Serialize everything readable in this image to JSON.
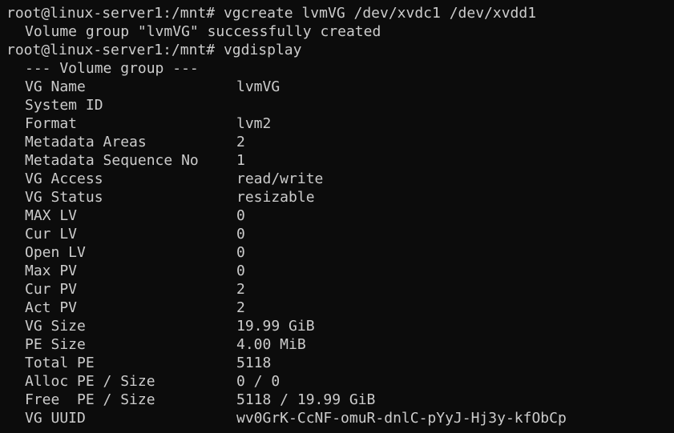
{
  "terminal": {
    "prompt": "root@linux-server1:/mnt#",
    "command1": "vgcreate lvmVG /dev/xvdc1 /dev/xvdd1",
    "output1": "Volume group \"lvmVG\" successfully created",
    "command2": "vgdisplay",
    "section_header": "--- Volume group ---",
    "fields": [
      {
        "key": "VG Name",
        "value": "lvmVG"
      },
      {
        "key": "System ID",
        "value": ""
      },
      {
        "key": "Format",
        "value": "lvm2"
      },
      {
        "key": "Metadata Areas",
        "value": "2"
      },
      {
        "key": "Metadata Sequence No",
        "value": "1"
      },
      {
        "key": "VG Access",
        "value": "read/write"
      },
      {
        "key": "VG Status",
        "value": "resizable"
      },
      {
        "key": "MAX LV",
        "value": "0"
      },
      {
        "key": "Cur LV",
        "value": "0"
      },
      {
        "key": "Open LV",
        "value": "0"
      },
      {
        "key": "Max PV",
        "value": "0"
      },
      {
        "key": "Cur PV",
        "value": "2"
      },
      {
        "key": "Act PV",
        "value": "2"
      },
      {
        "key": "VG Size",
        "value": "19.99 GiB"
      },
      {
        "key": "PE Size",
        "value": "4.00 MiB"
      },
      {
        "key": "Total PE",
        "value": "5118"
      },
      {
        "key": "Alloc PE / Size",
        "value": "0 / 0"
      },
      {
        "key": "Free  PE / Size",
        "value": "5118 / 19.99 GiB"
      },
      {
        "key": "VG UUID",
        "value": "wv0GrK-CcNF-omuR-dnlC-pYyJ-Hj3y-kfObCp"
      }
    ]
  },
  "colors": {
    "background": "#0c0c0c",
    "foreground": "#cccccc"
  }
}
